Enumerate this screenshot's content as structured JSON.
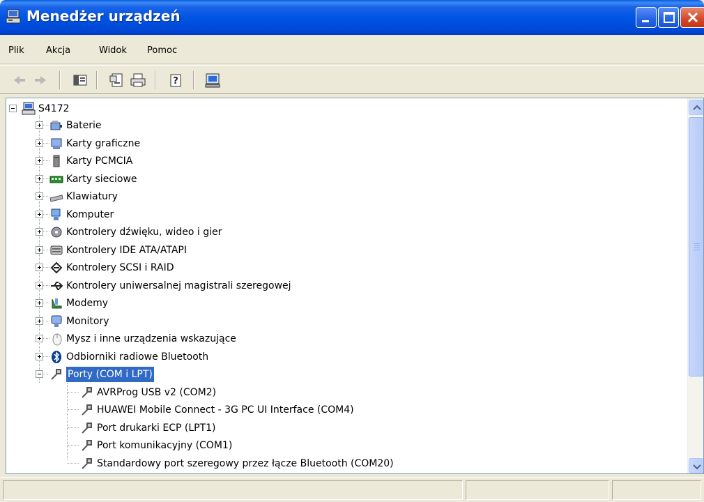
{
  "window": {
    "title": "Menedżer urządzeń"
  },
  "menu": [
    "Plik",
    "Akcja",
    "Widok",
    "Pomoc"
  ],
  "toolbar": {
    "icons": [
      "back-arrow-icon",
      "forward-arrow-icon",
      "show-hide-tree-icon",
      "properties-icon",
      "print-icon",
      "help-icon",
      "scan-hardware-icon"
    ]
  },
  "tree": {
    "root": "S4172",
    "categories": [
      {
        "label": "Baterie",
        "icon": "battery-icon"
      },
      {
        "label": "Karty graficzne",
        "icon": "display-adapter-icon"
      },
      {
        "label": "Karty PCMCIA",
        "icon": "pcmcia-icon"
      },
      {
        "label": "Karty sieciowe",
        "icon": "network-adapter-icon"
      },
      {
        "label": "Klawiatury",
        "icon": "keyboard-icon"
      },
      {
        "label": "Komputer",
        "icon": "computer-icon"
      },
      {
        "label": "Kontrolery dźwięku, wideo i gier",
        "icon": "sound-video-icon"
      },
      {
        "label": "Kontrolery IDE ATA/ATAPI",
        "icon": "ide-controller-icon"
      },
      {
        "label": "Kontrolery SCSI i RAID",
        "icon": "scsi-raid-icon"
      },
      {
        "label": "Kontrolery uniwersalnej magistrali szeregowej",
        "icon": "usb-icon"
      },
      {
        "label": "Modemy",
        "icon": "modem-icon"
      },
      {
        "label": "Monitory",
        "icon": "monitor-icon"
      },
      {
        "label": "Mysz i inne urządzenia wskazujące",
        "icon": "mouse-icon"
      },
      {
        "label": "Odbiorniki radiowe Bluetooth",
        "icon": "bluetooth-icon"
      },
      {
        "label": "Porty (COM i LPT)",
        "icon": "port-icon",
        "expanded": true,
        "selected": true
      }
    ],
    "ports": [
      "AVRProg USB v2 (COM2)",
      "HUAWEI Mobile Connect - 3G PC UI Interface (COM4)",
      "Port drukarki ECP (LPT1)",
      "Port komunikacyjny (COM1)",
      "Standardowy port szeregowy przez łącze Bluetooth (COM20)"
    ]
  },
  "statusbar": {
    "cells": [
      "",
      "",
      ""
    ]
  }
}
